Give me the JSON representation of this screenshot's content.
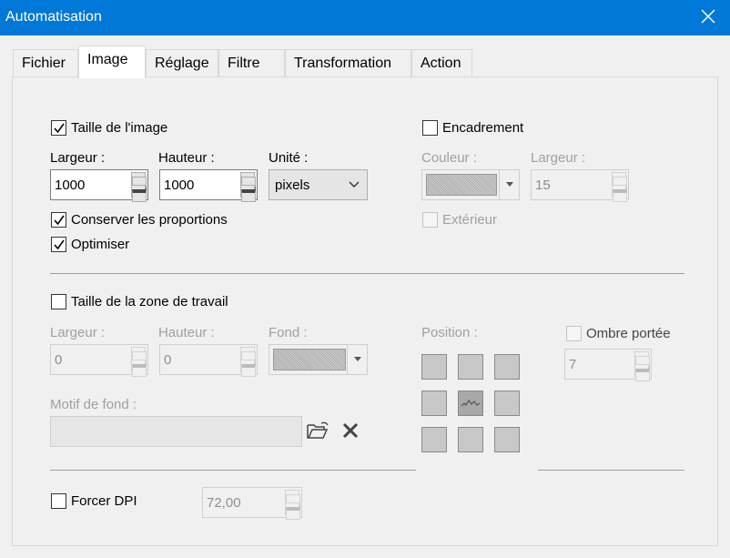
{
  "window": {
    "title": "Automatisation"
  },
  "tabs": [
    "Fichier",
    "Image",
    "Réglage",
    "Filtre",
    "Transformation",
    "Action"
  ],
  "image_size": {
    "checkbox_label": "Taille de l'image",
    "checked": true,
    "width_label": "Largeur :",
    "width_value": "1000",
    "height_label": "Hauteur :",
    "height_value": "1000",
    "unit_label": "Unité :",
    "unit_value": "pixels",
    "keep_ratio_label": "Conserver les proportions",
    "keep_ratio_checked": true,
    "optimize_label": "Optimiser",
    "optimize_checked": true
  },
  "frame": {
    "checkbox_label": "Encadrement",
    "checked": false,
    "color_label": "Couleur :",
    "width_label": "Largeur :",
    "width_value": "15",
    "outside_label": "Extérieur"
  },
  "canvas": {
    "checkbox_label": "Taille de la zone de travail",
    "checked": false,
    "width_label": "Largeur :",
    "width_value": "0",
    "height_label": "Hauteur :",
    "height_value": "0",
    "bg_label": "Fond :",
    "position_label": "Position :",
    "shadow_label": "Ombre portée",
    "shadow_value": "7",
    "pattern_label": "Motif de fond :"
  },
  "dpi": {
    "checkbox_label": "Forcer DPI",
    "checked": false,
    "value": "72,00"
  }
}
